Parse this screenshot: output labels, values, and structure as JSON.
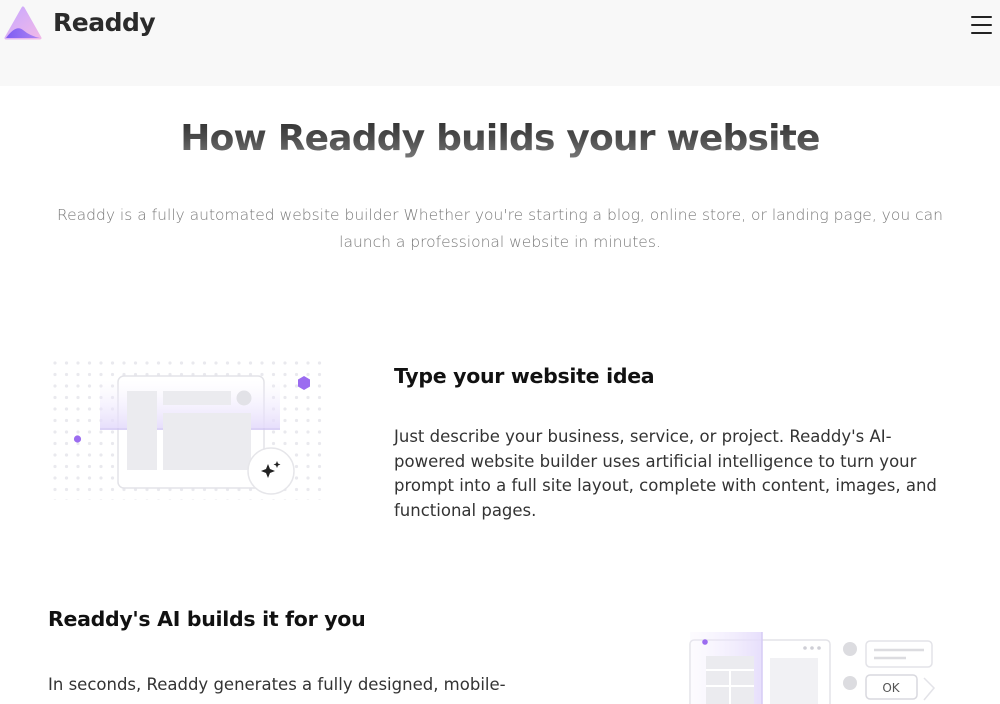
{
  "header": {
    "brand_name": "Readdy",
    "logo_icon": "readdy-logo-icon",
    "menu_icon": "hamburger-menu-icon"
  },
  "hero": {
    "title": "How Readdy builds your website",
    "description": "Readdy is a fully automated website builder Whether you're starting a blog, online store, or landing page, you can launch a professional website in minutes."
  },
  "features": [
    {
      "title": "Type your website idea",
      "text": "Just describe your business, service, or project. Readdy's AI-powered website builder uses artificial intelligence to turn your prompt into a full site layout, complete with content, images, and functional pages.",
      "illustration_icon": "website-layout-sparkle-illustration"
    },
    {
      "title": "Readdy's AI builds it for you",
      "text": "In seconds, Readdy generates a fully designed, mobile-",
      "illustration_icon": "ai-builder-chat-illustration",
      "illustration_button_label": "OK"
    }
  ],
  "colors": {
    "accent": "#9b6cf0",
    "title_dark": "#2e2e2e",
    "muted_text": "#7a7a7a",
    "header_bg": "#f8f8f8"
  }
}
